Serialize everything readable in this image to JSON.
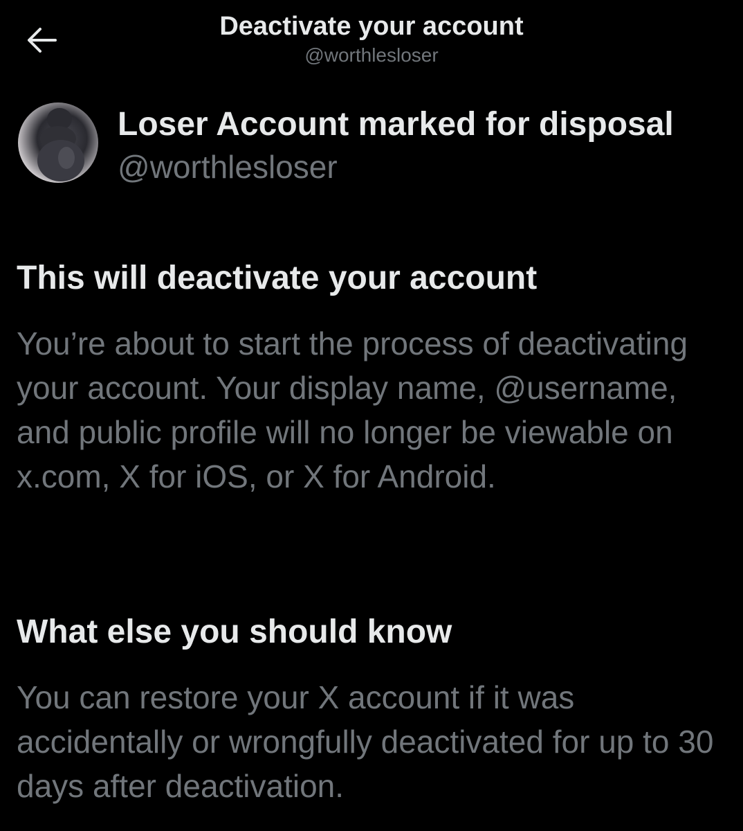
{
  "header": {
    "title": "Deactivate your account",
    "subtitle": "@worthlesloser"
  },
  "profile": {
    "display_name": "Loser Account marked for disposal",
    "handle": "@worthlesloser"
  },
  "sections": [
    {
      "heading": "This will deactivate your account",
      "body": "You’re about to start the process of deactivating your account. Your display name, @username, and public profile will no longer be viewable on x.com, X for iOS, or X for Android."
    },
    {
      "heading": "What else you should know",
      "body": "You can restore your X account if it was accidentally or wrongfully deactivated for up to 30 days after deactivation."
    }
  ],
  "icons": {
    "back": "arrow-left-icon"
  },
  "colors": {
    "background": "#000000",
    "primary_text": "#e7e9ea",
    "secondary_text": "#71767b"
  }
}
